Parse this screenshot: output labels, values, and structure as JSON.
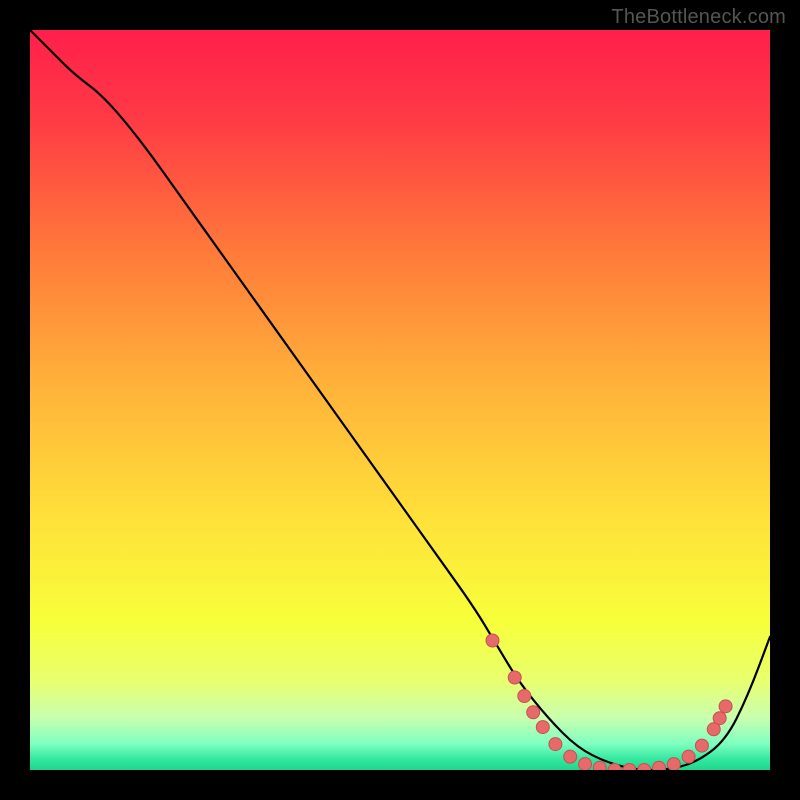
{
  "watermark": "TheBottleneck.com",
  "colors": {
    "gradient_stops": [
      {
        "offset": 0.0,
        "color": "#ff1f4b"
      },
      {
        "offset": 0.12,
        "color": "#ff3a45"
      },
      {
        "offset": 0.3,
        "color": "#ff7a3a"
      },
      {
        "offset": 0.48,
        "color": "#ffb23a"
      },
      {
        "offset": 0.66,
        "color": "#ffe13a"
      },
      {
        "offset": 0.8,
        "color": "#f7ff3a"
      },
      {
        "offset": 0.88,
        "color": "#e8ff70"
      },
      {
        "offset": 0.93,
        "color": "#c8ffb0"
      },
      {
        "offset": 0.965,
        "color": "#7dffc0"
      },
      {
        "offset": 0.985,
        "color": "#34e8a0"
      },
      {
        "offset": 1.0,
        "color": "#1fd68c"
      }
    ],
    "curve": "#000000",
    "marker": "#e66a6a",
    "marker_edge": "#c85050"
  },
  "chart_data": {
    "type": "line",
    "title": "",
    "xlabel": "",
    "ylabel": "",
    "xlim": [
      0,
      100
    ],
    "ylim": [
      0,
      100
    ],
    "grid": false,
    "legend": false,
    "series": [
      {
        "name": "curve",
        "x": [
          0,
          3,
          6,
          10,
          15,
          20,
          25,
          30,
          35,
          40,
          45,
          50,
          55,
          60,
          63,
          66,
          70,
          74,
          78,
          82,
          86,
          90,
          94,
          97,
          100
        ],
        "y": [
          100,
          97,
          94,
          91,
          85,
          78,
          71,
          64,
          57,
          50,
          43,
          36,
          29,
          22,
          17,
          12,
          7,
          3,
          1,
          0,
          0,
          1,
          4,
          10,
          18
        ]
      }
    ],
    "markers": [
      {
        "x": 62.5,
        "y": 17.5
      },
      {
        "x": 65.5,
        "y": 12.5
      },
      {
        "x": 66.8,
        "y": 10.0
      },
      {
        "x": 68.0,
        "y": 7.8
      },
      {
        "x": 69.3,
        "y": 5.8
      },
      {
        "x": 71.0,
        "y": 3.5
      },
      {
        "x": 73.0,
        "y": 1.8
      },
      {
        "x": 75.0,
        "y": 0.8
      },
      {
        "x": 77.0,
        "y": 0.3
      },
      {
        "x": 79.0,
        "y": 0.0
      },
      {
        "x": 81.0,
        "y": 0.0
      },
      {
        "x": 83.0,
        "y": 0.0
      },
      {
        "x": 85.0,
        "y": 0.3
      },
      {
        "x": 87.0,
        "y": 0.8
      },
      {
        "x": 89.0,
        "y": 1.8
      },
      {
        "x": 90.8,
        "y": 3.3
      },
      {
        "x": 92.4,
        "y": 5.5
      },
      {
        "x": 93.2,
        "y": 7.0
      },
      {
        "x": 94.0,
        "y": 8.6
      }
    ]
  }
}
